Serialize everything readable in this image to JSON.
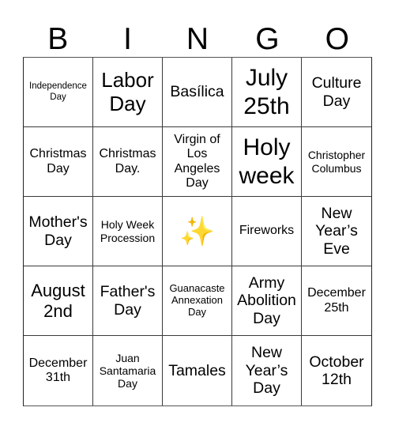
{
  "header": {
    "letters": [
      "B",
      "I",
      "N",
      "G",
      "O"
    ]
  },
  "board": {
    "rows": [
      [
        "Independence Day",
        "Labor Day",
        "Basílica",
        "July 25th",
        "Culture Day"
      ],
      [
        "Christmas Day",
        "Christmas Day.",
        "Virgin of Los Angeles Day",
        "Holy week",
        "Christopher Columbus"
      ],
      [
        "Mother's Day",
        "Holy Week Procession",
        "✨",
        "Fireworks",
        "New Year’s Eve"
      ],
      [
        "August 2nd",
        "Father's Day",
        "Guanacaste Annexation Day",
        "Army Abolition Day",
        "December 25th"
      ],
      [
        "December 31th",
        "Juan Santamaria Day",
        "Tamales",
        "New Year’s Day",
        "October 12th"
      ]
    ],
    "free_space": {
      "row": 2,
      "col": 2,
      "icon": "sparkles-icon",
      "glyph": "✨"
    }
  }
}
